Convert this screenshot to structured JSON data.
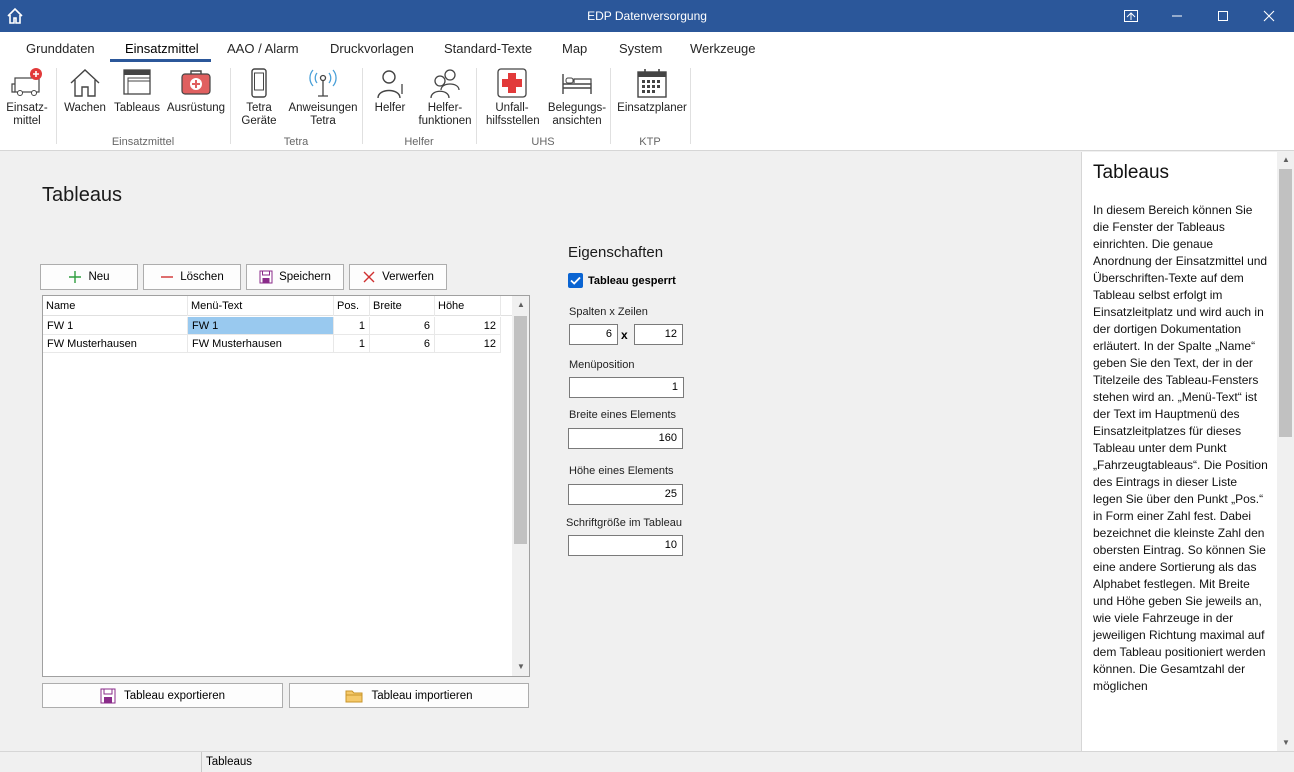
{
  "window": {
    "title": "EDP Datenversorgung"
  },
  "tabs": [
    "Grunddaten",
    "Einsatzmittel",
    "AAO / Alarm",
    "Druckvorlagen",
    "Standard-Texte",
    "Map",
    "System",
    "Werkzeuge"
  ],
  "ribbon": {
    "buttons": [
      {
        "label": "Einsatz-\nmittel",
        "icon": "ambulance-icon"
      },
      {
        "label": "Wachen",
        "icon": "house-icon"
      },
      {
        "label": "Tableaus",
        "icon": "windows-icon"
      },
      {
        "label": "Ausrüstung",
        "icon": "first-aid-kit-icon"
      },
      {
        "label": "Tetra\nGeräte",
        "icon": "phone-icon"
      },
      {
        "label": "Anweisungen\nTetra",
        "icon": "antenna-icon"
      },
      {
        "label": "Helfer",
        "icon": "person-icon"
      },
      {
        "label": "Helfer-\nfunktionen",
        "icon": "people-icon"
      },
      {
        "label": "Unfall-\nhilfsstellen",
        "icon": "cross-icon"
      },
      {
        "label": "Belegungs-\nansichten",
        "icon": "bed-icon"
      },
      {
        "label": "Einsatzplaner",
        "icon": "calendar-icon"
      }
    ],
    "groups": [
      "Einsatzmittel",
      "Tetra",
      "Helfer",
      "UHS",
      "KTP"
    ]
  },
  "page": {
    "title": "Tableaus"
  },
  "toolbar": {
    "new_label": "Neu",
    "delete_label": "Löschen",
    "save_label": "Speichern",
    "discard_label": "Verwerfen"
  },
  "table": {
    "columns": [
      "Name",
      "Menü-Text",
      "Pos.",
      "Breite",
      "Höhe"
    ],
    "rows": [
      {
        "name": "FW 1",
        "menu_text": "FW 1",
        "pos": "1",
        "width": "6",
        "height": "12"
      },
      {
        "name": "FW Musterhausen",
        "menu_text": "FW Musterhausen",
        "pos": "1",
        "width": "6",
        "height": "12"
      }
    ]
  },
  "bottom": {
    "export_label": "Tableau exportieren",
    "import_label": "Tableau importieren"
  },
  "properties": {
    "title": "Eigenschaften",
    "locked_label": "Tableau gesperrt",
    "locked": true,
    "cols_rows_label": "Spalten x Zeilen",
    "cols": "6",
    "x": "x",
    "rows": "12",
    "menu_pos_label": "Menüposition",
    "menu_pos": "1",
    "elem_width_label": "Breite eines Elements",
    "elem_width": "160",
    "elem_height_label": "Höhe eines Elements",
    "elem_height": "25",
    "font_size_label": "Schriftgröße im Tableau",
    "font_size": "10"
  },
  "help": {
    "title": "Tableaus",
    "text": "In diesem Bereich können Sie die Fenster der Tableaus einrichten. Die genaue Anordnung der Einsatzmittel und Überschriften-Texte auf dem Tableau selbst erfolgt im Einsatzleitplatz und wird auch in der dortigen Dokumentation erläutert. In der Spalte „Name“ geben Sie den Text, der in der Titelzeile des Tableau-Fensters stehen wird an. „Menü-Text“ ist der Text im Hauptmenü des Einsatzleitplatzes für dieses Tableau unter dem Punkt „Fahrzeugtableaus“. Die Position des Eintrags in dieser Liste legen Sie über den Punkt „Pos.“ in Form einer Zahl fest. Dabei bezeichnet die kleinste Zahl den obersten Eintrag. So können Sie eine andere Sortierung als das Alphabet festlegen. Mit Breite und Höhe geben Sie jeweils an, wie viele Fahrzeuge in der jeweiligen Richtung maximal auf dem Tableau positioniert werden können. Die Gesamtzahl der möglichen"
  },
  "statusbar": {
    "text": "Tableaus"
  },
  "colors": {
    "titlebar": "#2b579a",
    "accent": "#2b579a",
    "selection": "#99c9ef",
    "checkbox": "#0a64d2"
  }
}
